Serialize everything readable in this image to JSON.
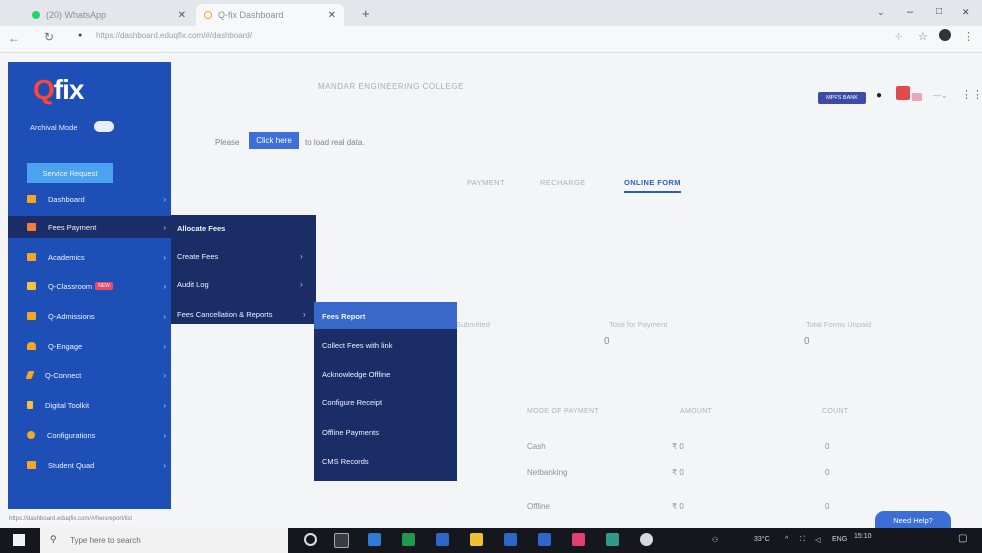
{
  "browser": {
    "tabs": [
      {
        "title": "(20) WhatsApp"
      },
      {
        "title": "Q-fix Dashboard"
      }
    ],
    "new_tab": "+",
    "url": "https://dashboard.eduqfix.com/#/dashboard/",
    "status_url": "https://dashboard.eduqfix.com/#/feesreport/list",
    "window_controls": {
      "minimize": "–",
      "maximize": "□",
      "close": "✕"
    }
  },
  "header": {
    "college_name": "MANDAR ENGINEERING COLLEGE",
    "badge": "MPFS BANK"
  },
  "notice": {
    "prefix": "Please",
    "button": "Click here",
    "suffix": "to load real data."
  },
  "page_tabs": [
    "PAYMENT",
    "RECHARGE",
    "ONLINE FORM"
  ],
  "active_tab": "ONLINE FORM",
  "stats": [
    {
      "label": "Submitted",
      "value": ""
    },
    {
      "label": "Total for Payment",
      "value": "0"
    },
    {
      "label": "Total Forms Unpaid",
      "value": "0"
    }
  ],
  "payment_table": {
    "headers": [
      "MODE OF PAYMENT",
      "AMOUNT",
      "COUNT"
    ],
    "rows": [
      {
        "mode": "Cash",
        "amount": "₹ 0",
        "count": "0"
      },
      {
        "mode": "Netbanking",
        "amount": "₹ 0",
        "count": "0"
      },
      {
        "mode": "Offline",
        "amount": "₹ 0",
        "count": "0"
      }
    ]
  },
  "sidebar": {
    "logo_q": "Q",
    "logo_rest": "fix",
    "archival_label": "Archival Mode",
    "service_request": "Service Request",
    "items": [
      {
        "label": "Dashboard",
        "color": "#f5a623"
      },
      {
        "label": "Fees Payment",
        "color": "#f57c3a"
      },
      {
        "label": "Academics",
        "color": "#f5a623"
      },
      {
        "label": "Q-Classroom",
        "color": "#f5c23a",
        "badge": "NEW"
      },
      {
        "label": "Q-Admissions",
        "color": "#f5a623"
      },
      {
        "label": "Q-Engage",
        "color": "#f5a623"
      },
      {
        "label": "Q-Connect",
        "color": "#f5a623"
      },
      {
        "label": "Digital Toolkit",
        "color": "#f5c23a"
      },
      {
        "label": "Configurations",
        "color": "#f5a623"
      },
      {
        "label": "Student Quad",
        "color": "#f5a623"
      }
    ]
  },
  "fees_submenu": [
    {
      "label": "Allocate Fees"
    },
    {
      "label": "Create Fees"
    },
    {
      "label": "Audit Log"
    },
    {
      "label": "Fees Cancellation & Reports"
    }
  ],
  "reports_submenu": [
    {
      "label": "Fees Report"
    },
    {
      "label": "Collect Fees with link"
    },
    {
      "label": "Acknowledge Offline"
    },
    {
      "label": "Configure Receipt"
    },
    {
      "label": "Offline Payments"
    },
    {
      "label": "CMS Records"
    }
  ],
  "help_button": "Need Help?",
  "taskbar": {
    "search_placeholder": "Type here to search",
    "weather": "33°C",
    "language": "ENG",
    "time": "15:10"
  }
}
